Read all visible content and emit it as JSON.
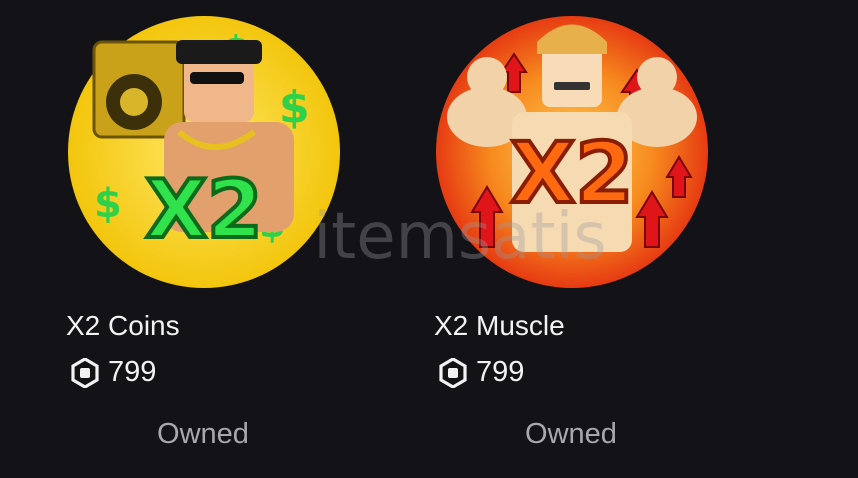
{
  "items": [
    {
      "name": "X2 Coins",
      "price": "799",
      "status": "Owned",
      "badge_text": "X2",
      "icon": "x2-coins-gamepass-icon",
      "colors": {
        "ring": "#f6d21a",
        "badge": "#2ee04a"
      }
    },
    {
      "name": "X2 Muscle",
      "price": "799",
      "status": "Owned",
      "badge_text": "X2",
      "icon": "x2-muscle-gamepass-icon",
      "colors": {
        "ring": "#f25a18",
        "badge": "#ff6a10"
      }
    }
  ],
  "currency_icon": "robux-icon",
  "watermark": "itemsatis"
}
